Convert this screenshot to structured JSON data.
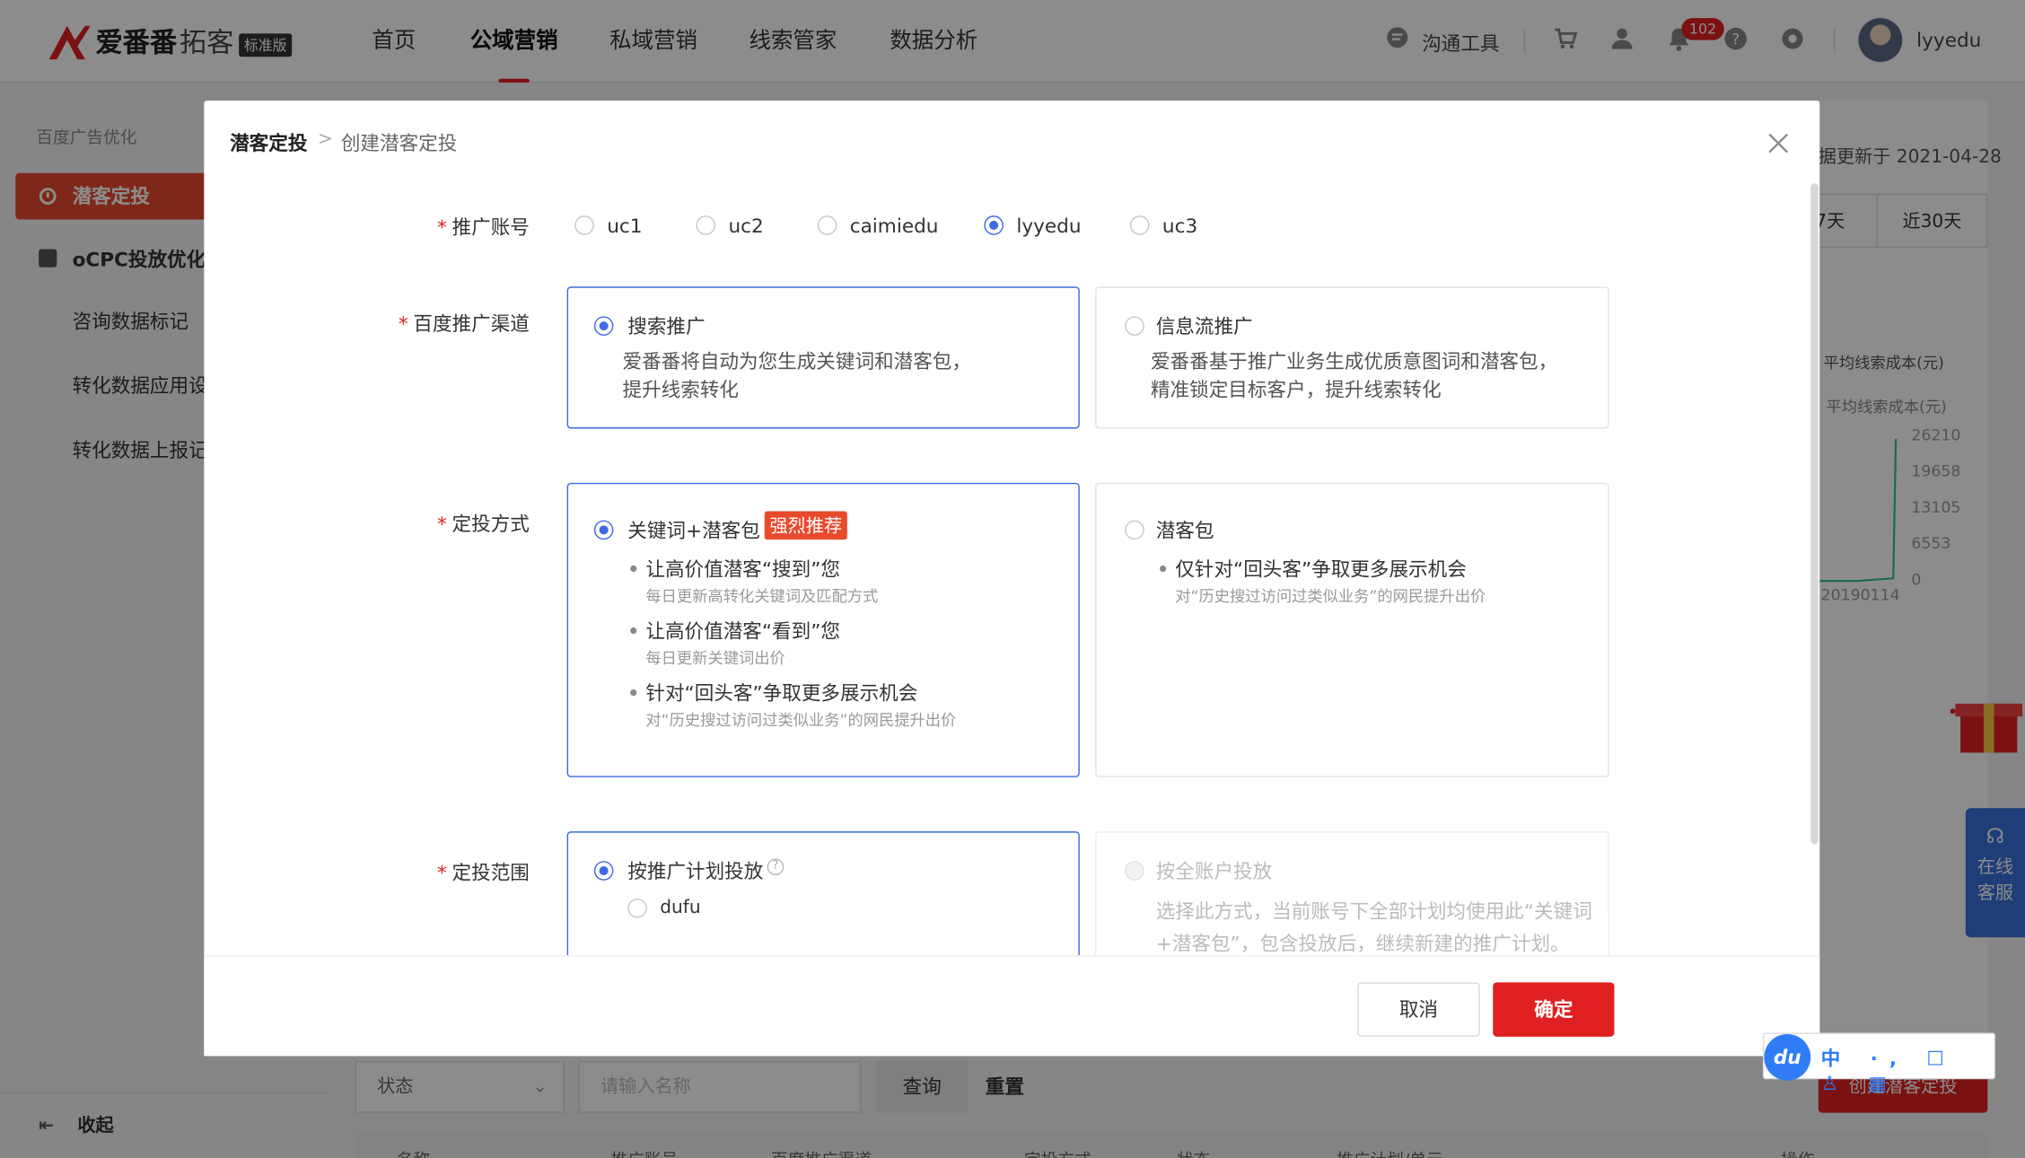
{
  "app": {
    "logo_name": "爱番番",
    "logo_sub": "拓客",
    "logo_badge": "标准版"
  },
  "nav": {
    "items": [
      "首页",
      "公域营销",
      "私域营销",
      "线索管家",
      "数据分析"
    ],
    "active": "公域营销",
    "tool_label": "沟通工具",
    "notification_count": "102",
    "username": "lyyedu"
  },
  "sidebar": {
    "section": "百度广告优化",
    "items": [
      "潜客定投",
      "oCPC投放优化",
      "咨询数据标记",
      "转化数据应用设",
      "转化数据上报记"
    ],
    "collapse": "收起"
  },
  "background": {
    "updated": "据更新于 2021-04-28",
    "range_buttons": [
      "7天",
      "近30天"
    ],
    "legend_1": "平均线索成本(元)",
    "legend_2": "平均线索成本(元)",
    "y_ticks": [
      "26210",
      "19658",
      "13105",
      "6553",
      "0"
    ],
    "x_tick": "20190114",
    "service": [
      "在线",
      "客服"
    ],
    "filter_status": "状态",
    "filter_name_placeholder": "请输入名称",
    "query": "查询",
    "reset": "重置",
    "create": "创建潜客定投",
    "table_headers": [
      "名称",
      "推广账号",
      "百度推广渠道",
      "定投方式",
      "状态",
      "推广计划/单元",
      "操作"
    ]
  },
  "ime": {
    "logo": "du",
    "items": "中 ·, ☐ ♙ ▦"
  },
  "modal": {
    "breadcrumb_root": "潜客定投",
    "breadcrumb_sep": ">",
    "breadcrumb_current": "创建潜客定投",
    "required_mark": "*",
    "account_label": "推广账号",
    "accounts": [
      "uc1",
      "uc2",
      "caimiedu",
      "lyyedu",
      "uc3"
    ],
    "account_selected": "lyyedu",
    "channel_label": "百度推广渠道",
    "channels": [
      {
        "title": "搜索推广",
        "desc_1": "爱番番将自动为您生成关键词和潜客包，",
        "desc_2": "提升线索转化",
        "selected": true
      },
      {
        "title": "信息流推广",
        "desc_1": "爱番番基于推广业务生成优质意图词和潜客包，",
        "desc_2": "精准锁定目标客户，提升线索转化",
        "selected": false
      }
    ],
    "mode_label": "定投方式",
    "modes": [
      {
        "title": "关键词+潜客包",
        "tag": "强烈推荐",
        "selected": true,
        "bullets": [
          {
            "title": "让高价值潜客“搜到”您",
            "sub": "每日更新高转化关键词及匹配方式"
          },
          {
            "title": "让高价值潜客“看到”您",
            "sub": "每日更新关键词出价"
          },
          {
            "title": "针对“回头客”争取更多展示机会",
            "sub": "对“历史搜过访问过类似业务”的网民提升出价"
          }
        ]
      },
      {
        "title": "潜客包",
        "selected": false,
        "bullets": [
          {
            "title": "仅针对“回头客”争取更多展示机会",
            "sub": "对“历史搜过访问过类似业务”的网民提升出价"
          }
        ]
      }
    ],
    "scope_label": "定投范围",
    "scopes": [
      {
        "title": "按推广计划投放",
        "option": "dufu",
        "selected": true
      },
      {
        "title": "按全账户投放",
        "desc_1": "选择此方式，当前账号下全部计划均使用此“关键词",
        "desc_2": "+潜客包”，包含投放后，继续新建的推广计划。",
        "disabled": true
      }
    ],
    "cancel": "取消",
    "confirm": "确定"
  },
  "colors": {
    "brand_red": "#e02020",
    "accent_blue": "#3f6ae0",
    "sidebar_active": "#e84a2e"
  }
}
